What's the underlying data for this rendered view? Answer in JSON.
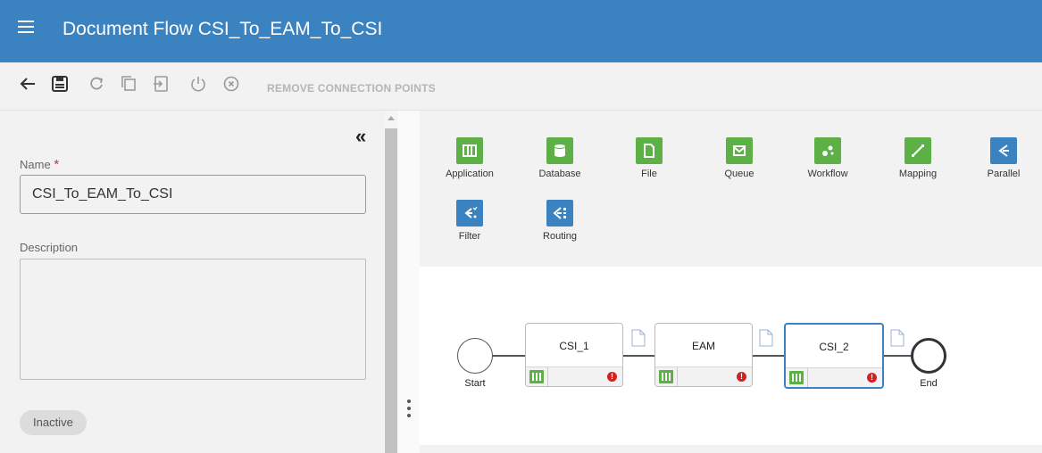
{
  "header": {
    "title": "Document Flow CSI_To_EAM_To_CSI"
  },
  "toolbar": {
    "remove_connection_points": "REMOVE CONNECTION POINTS"
  },
  "form": {
    "name_label": "Name",
    "required_mark": "*",
    "name_value": "CSI_To_EAM_To_CSI",
    "description_label": "Description",
    "description_value": "",
    "collapse_glyph": "«",
    "status": "Inactive"
  },
  "palette": {
    "items": [
      {
        "label": "Application",
        "color": "#5cb046",
        "icon": "application-icon"
      },
      {
        "label": "Database",
        "color": "#5cb046",
        "icon": "database-icon"
      },
      {
        "label": "File",
        "color": "#5cb046",
        "icon": "file-icon"
      },
      {
        "label": "Queue",
        "color": "#5cb046",
        "icon": "queue-icon"
      },
      {
        "label": "Workflow",
        "color": "#5cb046",
        "icon": "workflow-icon"
      },
      {
        "label": "Mapping",
        "color": "#5cb046",
        "icon": "mapping-icon"
      },
      {
        "label": "Parallel",
        "color": "#3b82c0",
        "icon": "parallel-icon"
      },
      {
        "label": "Filter",
        "color": "#3b82c0",
        "icon": "filter-icon"
      },
      {
        "label": "Routing",
        "color": "#3b82c0",
        "icon": "routing-icon"
      }
    ]
  },
  "flow": {
    "start_label": "Start",
    "end_label": "End",
    "nodes": [
      {
        "title": "CSI_1",
        "selected": false
      },
      {
        "title": "EAM",
        "selected": false
      },
      {
        "title": "CSI_2",
        "selected": true
      }
    ],
    "error_glyph": "!"
  },
  "colors": {
    "header": "#3b82c0",
    "green": "#5cb046",
    "blue": "#3b82c0",
    "error": "#d42020"
  }
}
